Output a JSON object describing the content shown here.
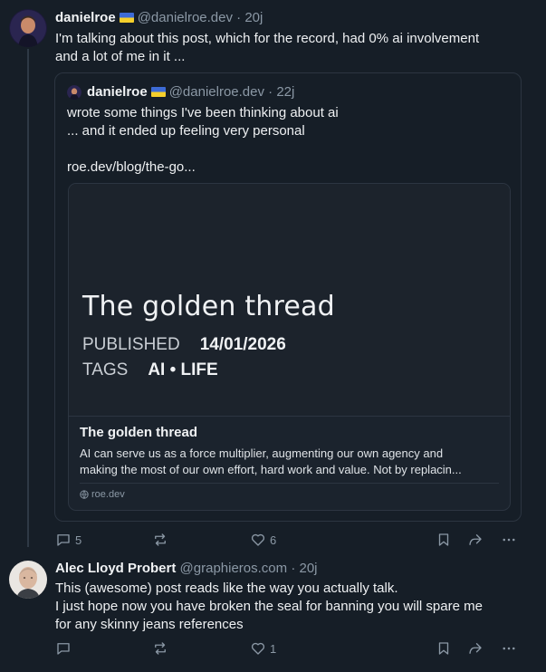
{
  "post1": {
    "author": "danielroe",
    "handle": "@danielroe.dev",
    "time": "· 20j",
    "lines": [
      "I'm talking about this post, which for the record, had 0% ai involvement",
      "and a lot of me in it ..."
    ],
    "quote": {
      "author": "danielroe",
      "handle": "@danielroe.dev",
      "time": "· 22j",
      "lines": [
        "wrote some things I've been thinking about ai",
        "... and it ended up feeling very personal",
        "",
        "roe.dev/blog/the-go..."
      ],
      "card": {
        "og_title": "The golden thread",
        "published_label": "PUBLISHED",
        "published_value": "14/01/2026",
        "tags_label": "TAGS",
        "tags_value": "AI • LIFE",
        "title": "The golden thread",
        "desc_lines": [
          "AI can serve us as a force multiplier, augmenting our own agency and",
          "making the most of our own effort, hard work and value. Not by replacin..."
        ],
        "domain": "roe.dev"
      }
    },
    "actions": {
      "replies": "5",
      "reposts": "",
      "likes": "6"
    }
  },
  "post2": {
    "author": "Alec Lloyd Probert",
    "handle": "@graphieros.com",
    "time": "· 20j",
    "lines": [
      "This (awesome) post reads like the way you actually talk.",
      "I just hope now you have broken the seal for banning you will spare me",
      "for any skinny jeans references"
    ],
    "actions": {
      "replies": "",
      "reposts": "",
      "likes": "1"
    }
  },
  "icons": [
    "reply-icon",
    "repost-icon",
    "like-icon",
    "bookmark-icon",
    "share-icon",
    "more-icon",
    "globe-icon"
  ]
}
